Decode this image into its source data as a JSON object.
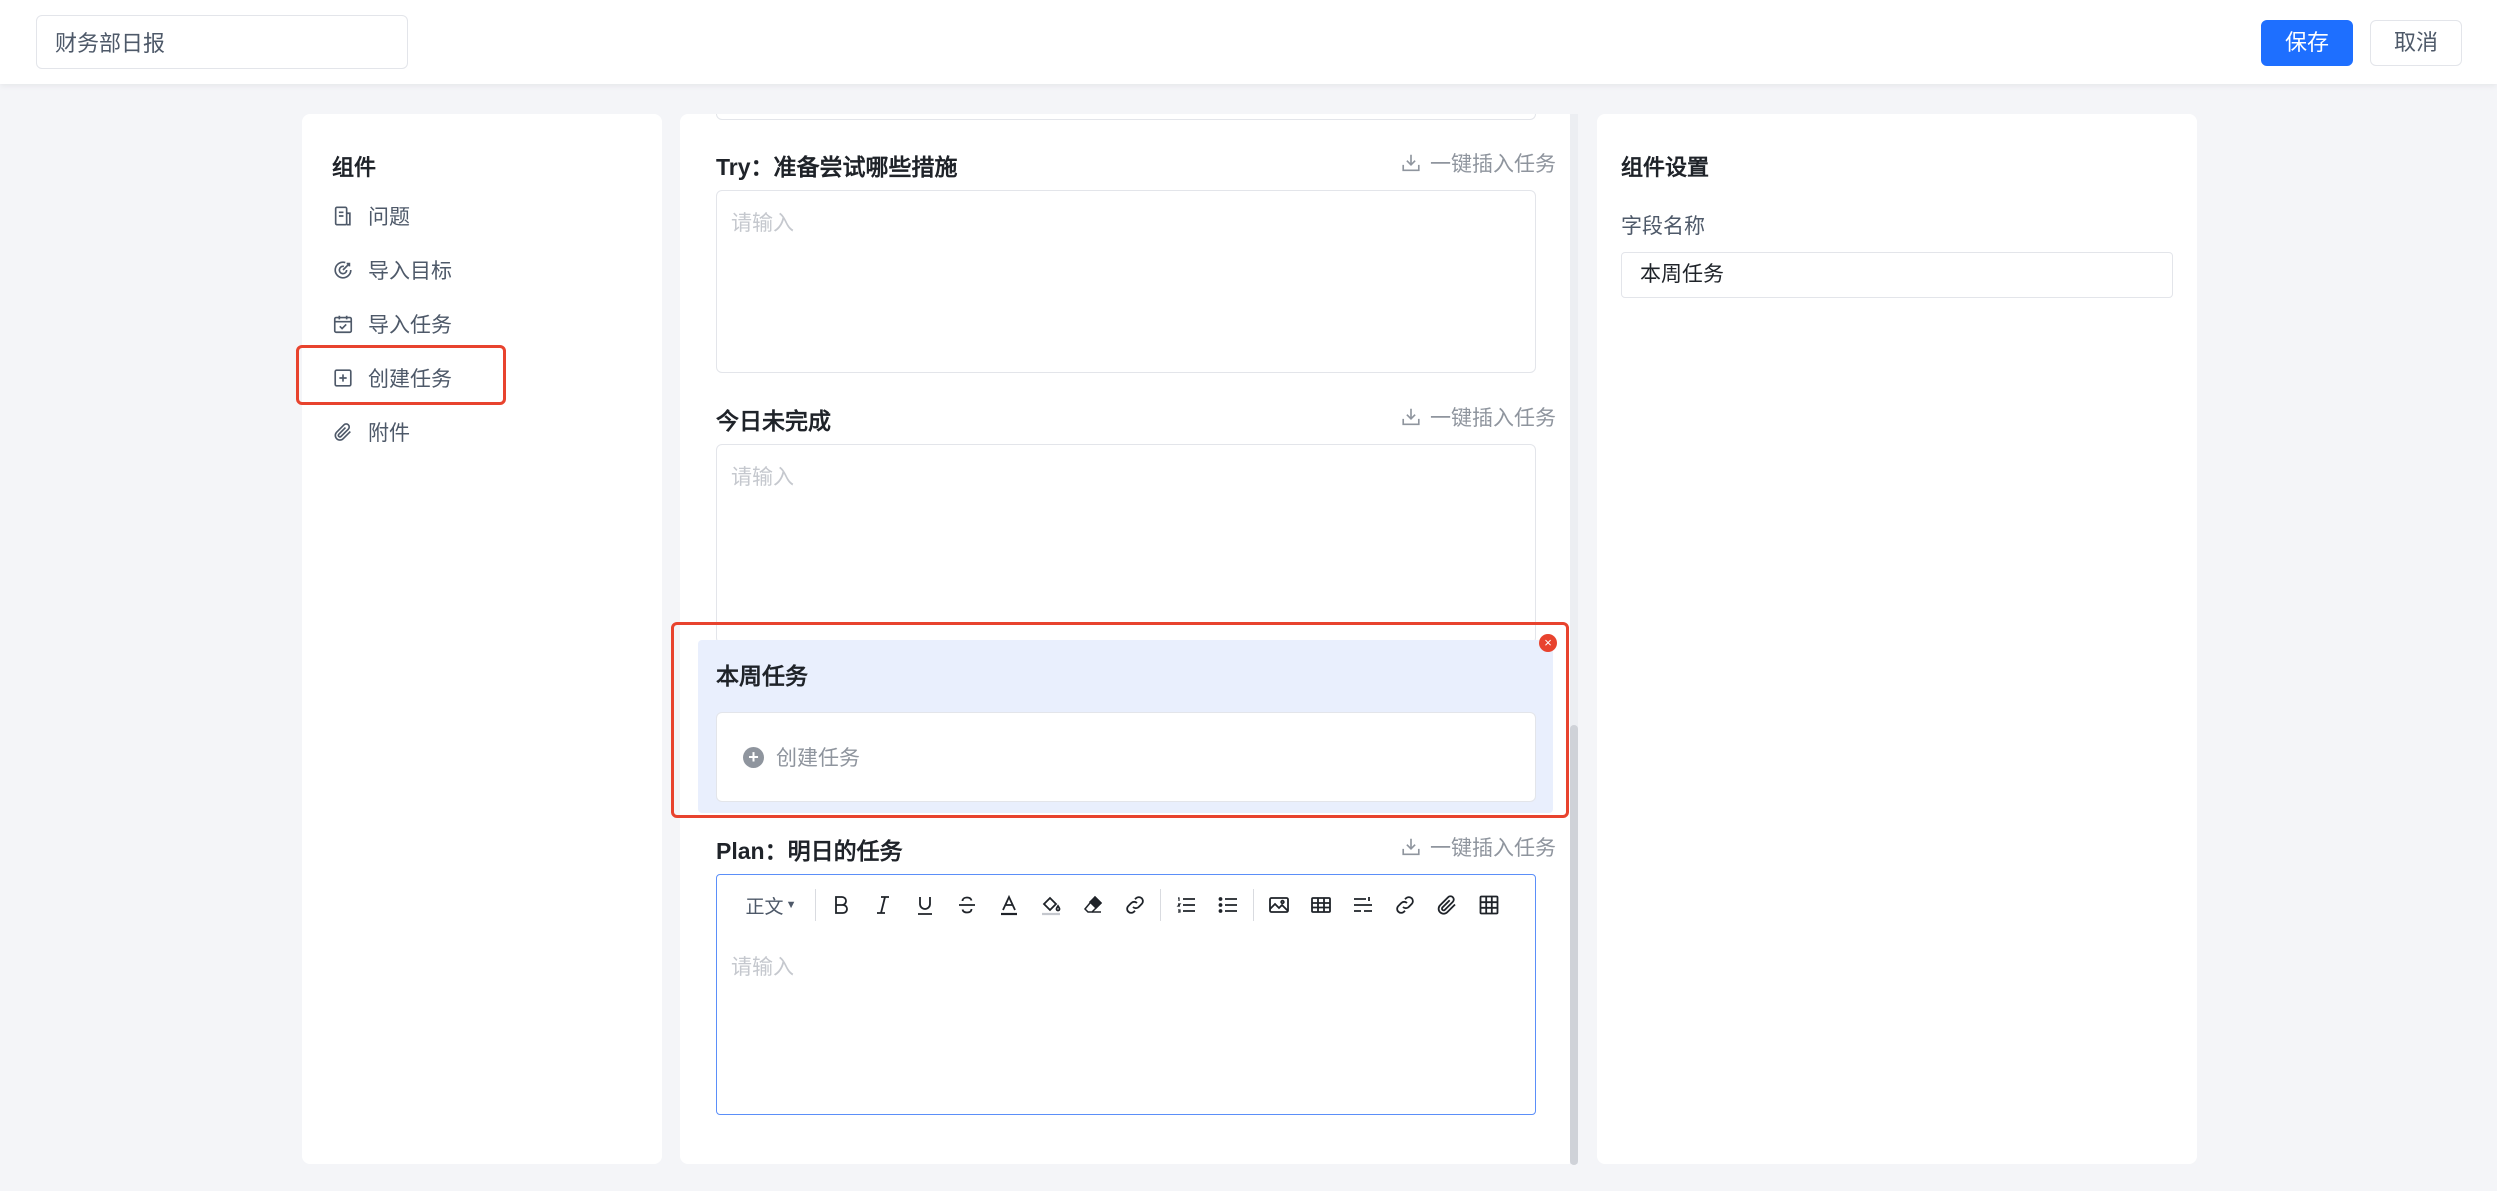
{
  "header": {
    "title_value": "财务部日报",
    "save_label": "保存",
    "cancel_label": "取消"
  },
  "components": {
    "title": "组件",
    "items": [
      {
        "label": "问题",
        "icon": "document-icon"
      },
      {
        "label": "导入目标",
        "icon": "target-icon"
      },
      {
        "label": "导入任务",
        "icon": "calendar-check-icon"
      },
      {
        "label": "创建任务",
        "icon": "plus-square-icon"
      },
      {
        "label": "附件",
        "icon": "paperclip-icon"
      }
    ]
  },
  "form": {
    "sections": [
      {
        "title": "Try：准备尝试哪些措施",
        "insert_label": "一键插入任务",
        "placeholder": "请输入"
      },
      {
        "title": "今日未完成",
        "insert_label": "一键插入任务",
        "placeholder": "请输入"
      },
      {
        "title": "Plan：明日的任务",
        "insert_label": "一键插入任务",
        "placeholder": "请输入"
      }
    ],
    "selected_block": {
      "title": "本周任务",
      "create_label": "创建任务"
    },
    "editor": {
      "style_label": "正文"
    }
  },
  "settings": {
    "title": "组件设置",
    "field_label": "字段名称",
    "field_value": "本周任务"
  },
  "colors": {
    "primary": "#1e6fff",
    "highlight": "#e8432e",
    "selected_bg": "#e9effd"
  }
}
